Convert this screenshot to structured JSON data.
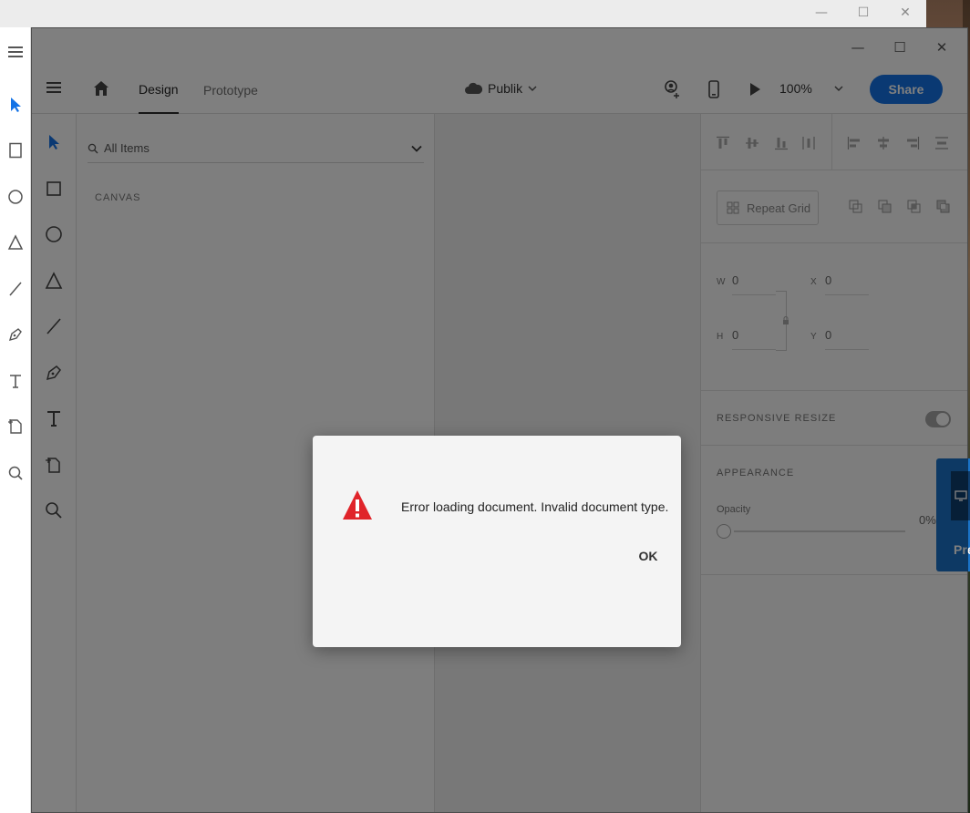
{
  "app": {
    "tabs": [
      {
        "label": "Design",
        "active": true
      },
      {
        "label": "Prototype",
        "active": false
      }
    ],
    "cloud_doc": "Publik",
    "zoom": "100%",
    "share_label": "Share"
  },
  "layers": {
    "search_placeholder": "All Items",
    "section_label": "CANVAS"
  },
  "properties": {
    "repeat_grid_label": "Repeat Grid",
    "w_label": "W",
    "w_value": "0",
    "h_label": "H",
    "h_value": "0",
    "x_label": "X",
    "x_value": "0",
    "y_label": "Y",
    "y_value": "0",
    "responsive_label": "RESPONSIVE RESIZE",
    "appearance_label": "APPEARANCE",
    "opacity_label": "Opacity",
    "opacity_value": "0%"
  },
  "dialog": {
    "message": "Error loading document. Invalid document type.",
    "ok_label": "OK"
  },
  "background_popup": {
    "text": "Pre"
  },
  "colors": {
    "accent": "#1473e6",
    "error": "#e0242a",
    "tool_selected": "#1473e6"
  }
}
